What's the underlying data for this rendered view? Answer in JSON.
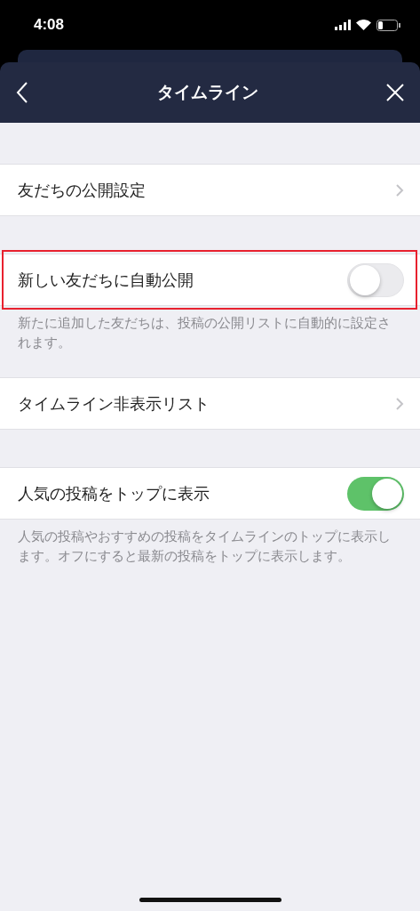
{
  "status_bar": {
    "time": "4:08"
  },
  "header": {
    "title": "タイムライン"
  },
  "sections": [
    {
      "rows": [
        {
          "kind": "link",
          "label": "友だちの公開設定",
          "highlighted": false
        }
      ]
    },
    {
      "rows": [
        {
          "kind": "toggle",
          "label": "新しい友だちに自動公開",
          "on": false,
          "highlighted": true
        }
      ],
      "note": "新たに追加した友だちは、投稿の公開リストに自動的に設定されます。"
    },
    {
      "rows": [
        {
          "kind": "link",
          "label": "タイムライン非表示リスト",
          "highlighted": false
        }
      ]
    },
    {
      "rows": [
        {
          "kind": "toggle",
          "label": "人気の投稿をトップに表示",
          "on": true,
          "highlighted": false
        }
      ],
      "note": "人気の投稿やおすすめの投稿をタイムラインのトップに表示します。オフにすると最新の投稿をトップに表示します。"
    }
  ]
}
